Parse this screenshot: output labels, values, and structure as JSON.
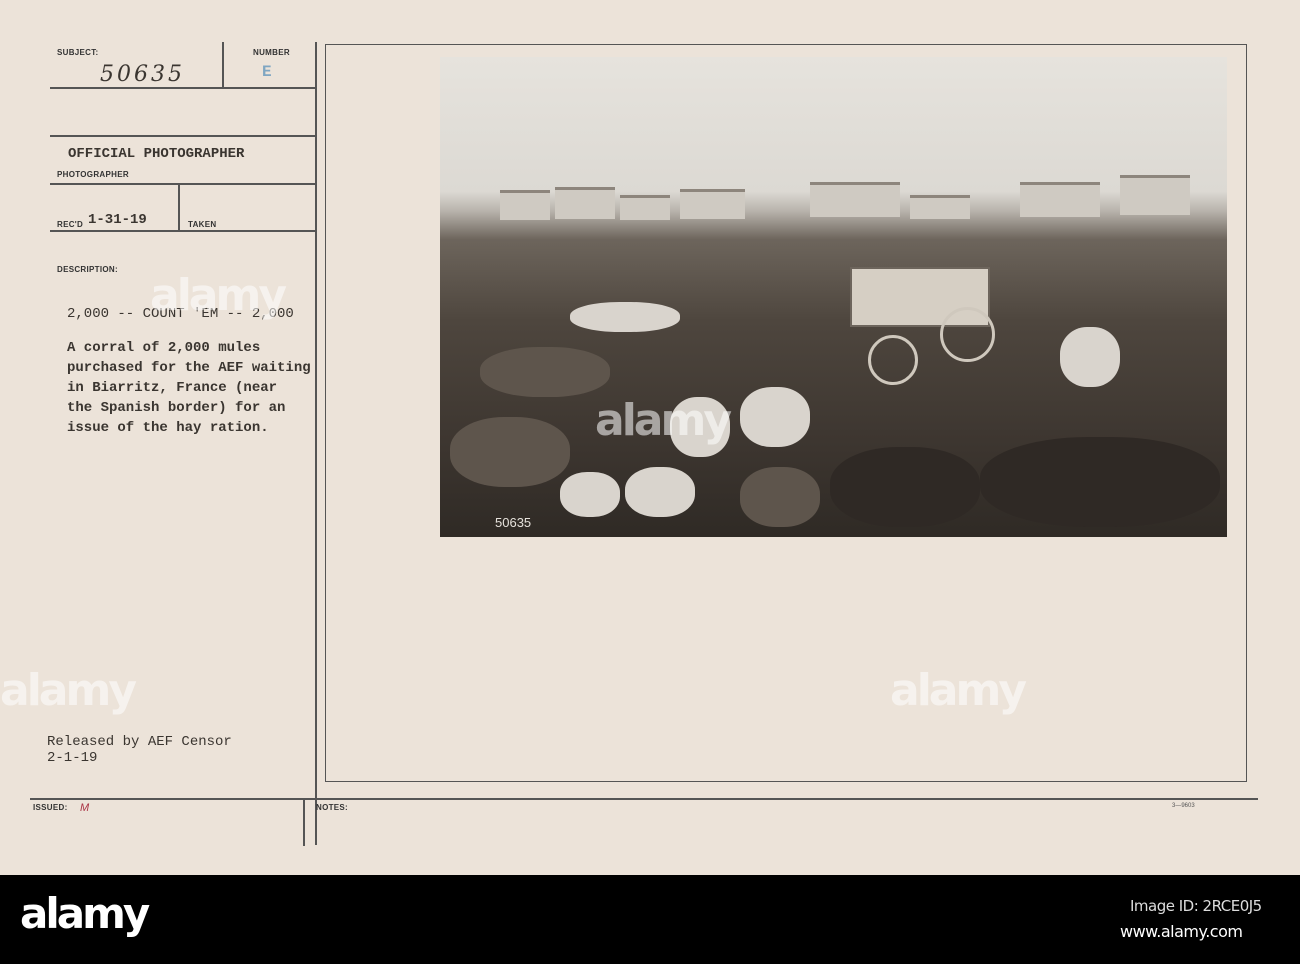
{
  "card": {
    "subject_label": "SUBJECT:",
    "subject_number": "50635",
    "number_label": "NUMBER",
    "number_stamp": "E",
    "photographer_value": "OFFICIAL PHOTOGRAPHER",
    "photographer_label": "PHOTOGRAPHER",
    "recd_label": "REC'D",
    "recd_date": "1-31-19",
    "taken_label": "TAKEN",
    "description_label": "DESCRIPTION:",
    "headline": "2,000 -- COUNT 'EM -- 2,000",
    "description_lines": [
      "A corral of 2,000 mules",
      "purchased for the AEF waiting",
      "in Biarritz, France (near",
      "the Spanish border) for an",
      "issue of the hay ration."
    ],
    "release_line1": "Released by AEF Censor",
    "release_line2": "2-1-19",
    "issued_label": "ISSUED:",
    "issued_value": "M",
    "notes_label": "NOTES:",
    "form_number": "3—9603"
  },
  "photo": {
    "negative_number": "50635"
  },
  "watermark": {
    "text": "alamy"
  },
  "footer": {
    "logo": "alamy",
    "image_id": "Image ID: 2RCE0J5",
    "url": "www.alamy.com"
  }
}
